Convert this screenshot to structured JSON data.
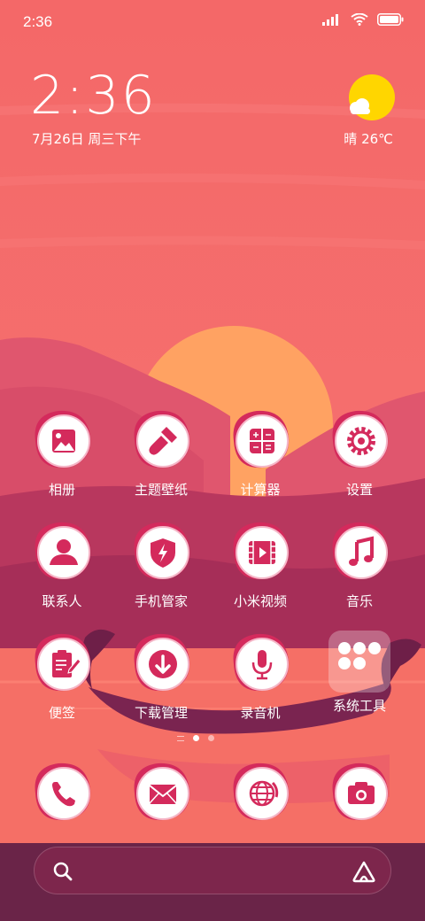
{
  "status_bar": {
    "time": "2:36"
  },
  "lockscreen": {
    "clock": "2:36",
    "date": "7月26日 周三下午",
    "weather": "晴 26℃"
  },
  "apps": [
    {
      "label": "相册",
      "icon": "gallery-icon"
    },
    {
      "label": "主题壁纸",
      "icon": "brush-icon"
    },
    {
      "label": "计算器",
      "icon": "calculator-icon"
    },
    {
      "label": "设置",
      "icon": "gear-icon"
    },
    {
      "label": "联系人",
      "icon": "contact-icon"
    },
    {
      "label": "手机管家",
      "icon": "shield-icon"
    },
    {
      "label": "小米视频",
      "icon": "video-icon"
    },
    {
      "label": "音乐",
      "icon": "music-icon"
    },
    {
      "label": "便签",
      "icon": "notepad-icon"
    },
    {
      "label": "下载管理",
      "icon": "download-icon"
    },
    {
      "label": "录音机",
      "icon": "microphone-icon"
    },
    {
      "label": "系统工具",
      "icon": "folder-icon"
    }
  ],
  "dock": [
    {
      "icon": "phone-icon"
    },
    {
      "icon": "mail-icon"
    },
    {
      "icon": "browser-icon"
    },
    {
      "icon": "camera-icon"
    }
  ],
  "pages": {
    "count": 2,
    "current": 1
  },
  "colors": {
    "accent": "#d42a5c",
    "sky": "#f46d6d",
    "sun": "#ffa262"
  }
}
